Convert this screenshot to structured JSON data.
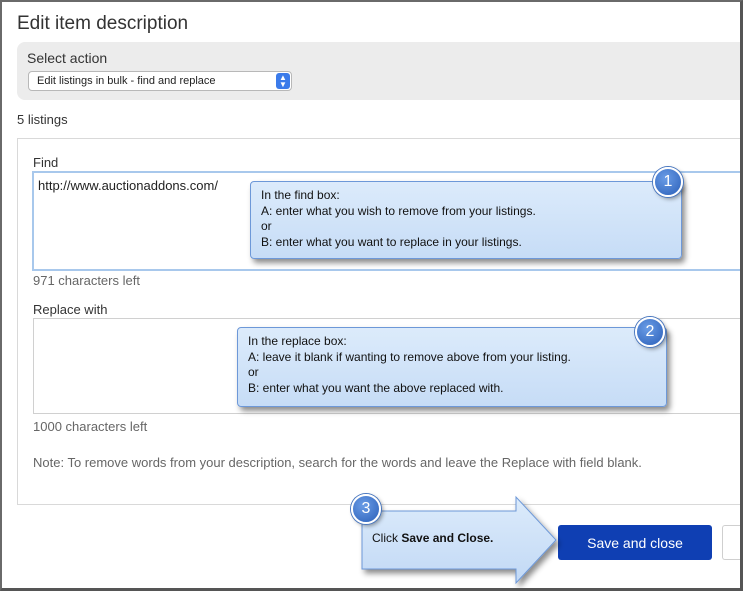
{
  "dialog": {
    "title": "Edit item description"
  },
  "action": {
    "label": "Select action",
    "selected_value": "Edit listings in bulk - find and replace"
  },
  "listings_count": "5 listings",
  "find": {
    "label": "Find",
    "value": "http://www.auctionaddons.com/",
    "chars_left": "971 characters left"
  },
  "replace": {
    "label": "Replace with",
    "value": "",
    "chars_left": "1000 characters left"
  },
  "note": "Note: To remove words from your description, search for the words and leave the Replace with field blank.",
  "buttons": {
    "save_close": "Save and close"
  },
  "callouts": {
    "one": {
      "number": "1",
      "lines": [
        "In the find box:",
        "A: enter what you wish to remove from your listings.",
        "or",
        "B: enter what you want to replace in your listings."
      ]
    },
    "two": {
      "number": "2",
      "lines": [
        "In the replace box:",
        "A: leave it blank if wanting to remove above from your listing.",
        "or",
        "B: enter what you want the above replaced with."
      ]
    },
    "three": {
      "number": "3",
      "prefix": "Click ",
      "bold": "Save and Close."
    }
  },
  "colors": {
    "primary_button": "#0f3fb3",
    "callout_fill": "#c6dcf6",
    "badge_blue": "#2a5fb8",
    "focus_border": "#a8c8ec"
  }
}
